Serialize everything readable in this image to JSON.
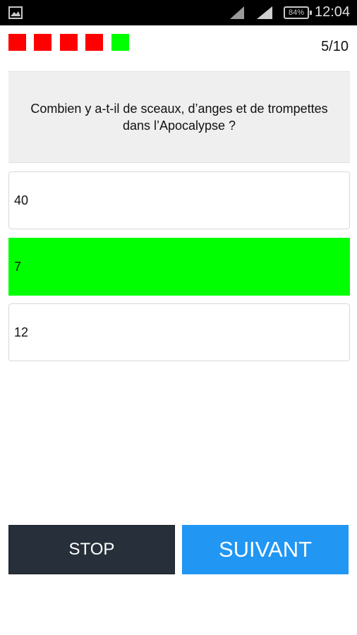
{
  "status_bar": {
    "time": "12:04",
    "battery": "84%",
    "icons": [
      "gallery-icon",
      "signal-icon",
      "signal-icon",
      "battery-icon"
    ]
  },
  "progress": {
    "counter": "5/10",
    "results": [
      {
        "status": "wrong",
        "color": "#ff0000"
      },
      {
        "status": "wrong",
        "color": "#ff0000"
      },
      {
        "status": "wrong",
        "color": "#ff0000"
      },
      {
        "status": "wrong",
        "color": "#ff0000"
      },
      {
        "status": "correct",
        "color": "#00ff00"
      }
    ]
  },
  "question": {
    "text": "Combien y a-t-il de sceaux, d’anges et de trompettes dans l’Apocalypse ?"
  },
  "answers": [
    {
      "label": "40",
      "state": "normal"
    },
    {
      "label": "7",
      "state": "correct",
      "color": "#00ff00"
    },
    {
      "label": "12",
      "state": "normal"
    }
  ],
  "buttons": {
    "stop_label": "STOP",
    "next_label": "SUIVANT",
    "stop_color": "#27303a",
    "next_color": "#2196f3"
  }
}
